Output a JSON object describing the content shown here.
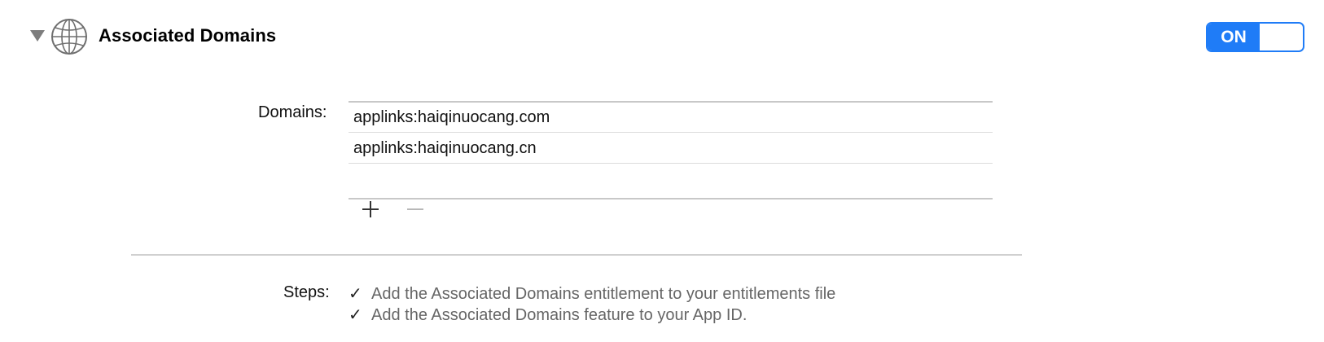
{
  "capability": {
    "title": "Associated Domains",
    "toggle_label": "ON",
    "toggle_state": "on",
    "expanded": true
  },
  "domains": {
    "label": "Domains:",
    "entries": [
      "applinks:haiqinuocang.com",
      "applinks:haiqinuocang.cn"
    ],
    "add_symbol": "+",
    "remove_symbol": "—"
  },
  "steps": {
    "label": "Steps:",
    "check_symbol": "✓",
    "items": [
      "Add the Associated Domains entitlement to your entitlements file",
      "Add the Associated Domains feature to your App ID."
    ]
  },
  "colors": {
    "accent": "#1f7cf7",
    "step_text": "#666666",
    "divider": "#d0d0d0"
  },
  "icons": {
    "capability": "globe-icon",
    "disclosure": "disclosure-triangle-icon"
  }
}
